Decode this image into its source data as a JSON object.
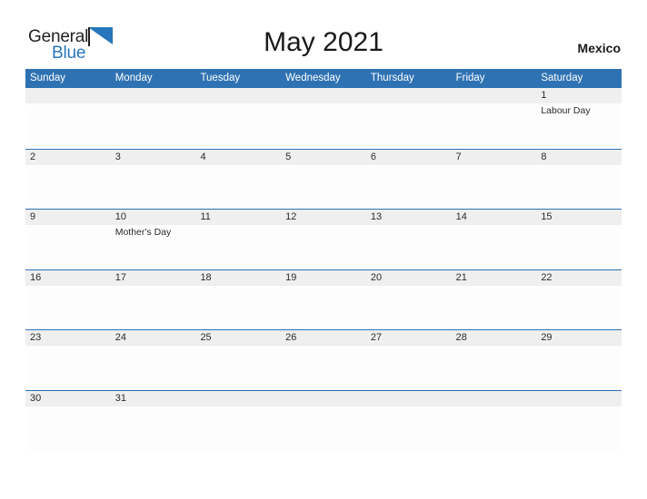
{
  "brand": {
    "name_part1": "General",
    "name_part2": "Blue",
    "flag_icon": "blue-flag-triangle",
    "color_dark": "#231f20",
    "color_blue": "#2776bb"
  },
  "header": {
    "title": "May 2021",
    "region": "Mexico"
  },
  "theme": {
    "header_blue": "#2e72b3",
    "rule_blue": "#2e72b3",
    "number_band_gray": "#efefef",
    "cell_white": "#fdfdfd",
    "text_dark": "#2b2b2b"
  },
  "calendar": {
    "month": "May",
    "year": "2021",
    "weekdays": [
      "Sunday",
      "Monday",
      "Tuesday",
      "Wednesday",
      "Thursday",
      "Friday",
      "Saturday"
    ],
    "weeks": [
      {
        "rule": false,
        "days": [
          {
            "num": "",
            "events": []
          },
          {
            "num": "",
            "events": []
          },
          {
            "num": "",
            "events": []
          },
          {
            "num": "",
            "events": []
          },
          {
            "num": "",
            "events": []
          },
          {
            "num": "",
            "events": []
          },
          {
            "num": "1",
            "events": [
              "Labour Day"
            ]
          }
        ]
      },
      {
        "rule": true,
        "days": [
          {
            "num": "2",
            "events": []
          },
          {
            "num": "3",
            "events": []
          },
          {
            "num": "4",
            "events": []
          },
          {
            "num": "5",
            "events": []
          },
          {
            "num": "6",
            "events": []
          },
          {
            "num": "7",
            "events": []
          },
          {
            "num": "8",
            "events": []
          }
        ]
      },
      {
        "rule": true,
        "days": [
          {
            "num": "9",
            "events": []
          },
          {
            "num": "10",
            "events": [
              "Mother's Day"
            ]
          },
          {
            "num": "11",
            "events": []
          },
          {
            "num": "12",
            "events": []
          },
          {
            "num": "13",
            "events": []
          },
          {
            "num": "14",
            "events": []
          },
          {
            "num": "15",
            "events": []
          }
        ]
      },
      {
        "rule": true,
        "days": [
          {
            "num": "16",
            "events": []
          },
          {
            "num": "17",
            "events": []
          },
          {
            "num": "18",
            "events": []
          },
          {
            "num": "19",
            "events": []
          },
          {
            "num": "20",
            "events": []
          },
          {
            "num": "21",
            "events": []
          },
          {
            "num": "22",
            "events": []
          }
        ]
      },
      {
        "rule": true,
        "days": [
          {
            "num": "23",
            "events": []
          },
          {
            "num": "24",
            "events": []
          },
          {
            "num": "25",
            "events": []
          },
          {
            "num": "26",
            "events": []
          },
          {
            "num": "27",
            "events": []
          },
          {
            "num": "28",
            "events": []
          },
          {
            "num": "29",
            "events": []
          }
        ]
      },
      {
        "rule": true,
        "days": [
          {
            "num": "30",
            "events": []
          },
          {
            "num": "31",
            "events": []
          },
          {
            "num": "",
            "events": []
          },
          {
            "num": "",
            "events": []
          },
          {
            "num": "",
            "events": []
          },
          {
            "num": "",
            "events": []
          },
          {
            "num": "",
            "events": []
          }
        ]
      }
    ]
  }
}
